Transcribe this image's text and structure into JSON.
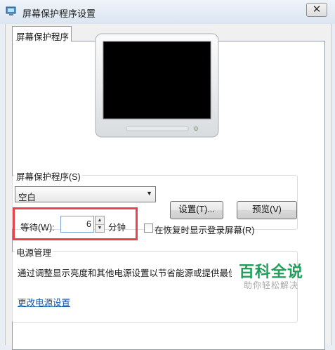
{
  "window": {
    "title": "屏幕保护程序设置",
    "close_label": "✕"
  },
  "tabs": [
    {
      "label": "屏幕保护程序"
    }
  ],
  "screensaver": {
    "group_label": "屏幕保护程序(S)",
    "selected": "空白",
    "settings_button": "设置(T)...",
    "preview_button": "预览(V)",
    "wait_label": "等待(W):",
    "wait_value": "6",
    "wait_unit": "分钟",
    "resume_checkbox_label": "在恢复时显示登录屏幕(R)",
    "resume_checked": false
  },
  "power": {
    "group_label": "电源管理",
    "description": "通过调整显示亮度和其他电源设置以节省能源或提供最佳",
    "link_text": "更改电源设置"
  },
  "watermark": {
    "main": "百科全说",
    "sub": "助你轻松解决"
  },
  "colors": {
    "highlight_border": "#e8434b",
    "link": "#0c53a8",
    "watermark": "#1e9f5a"
  }
}
